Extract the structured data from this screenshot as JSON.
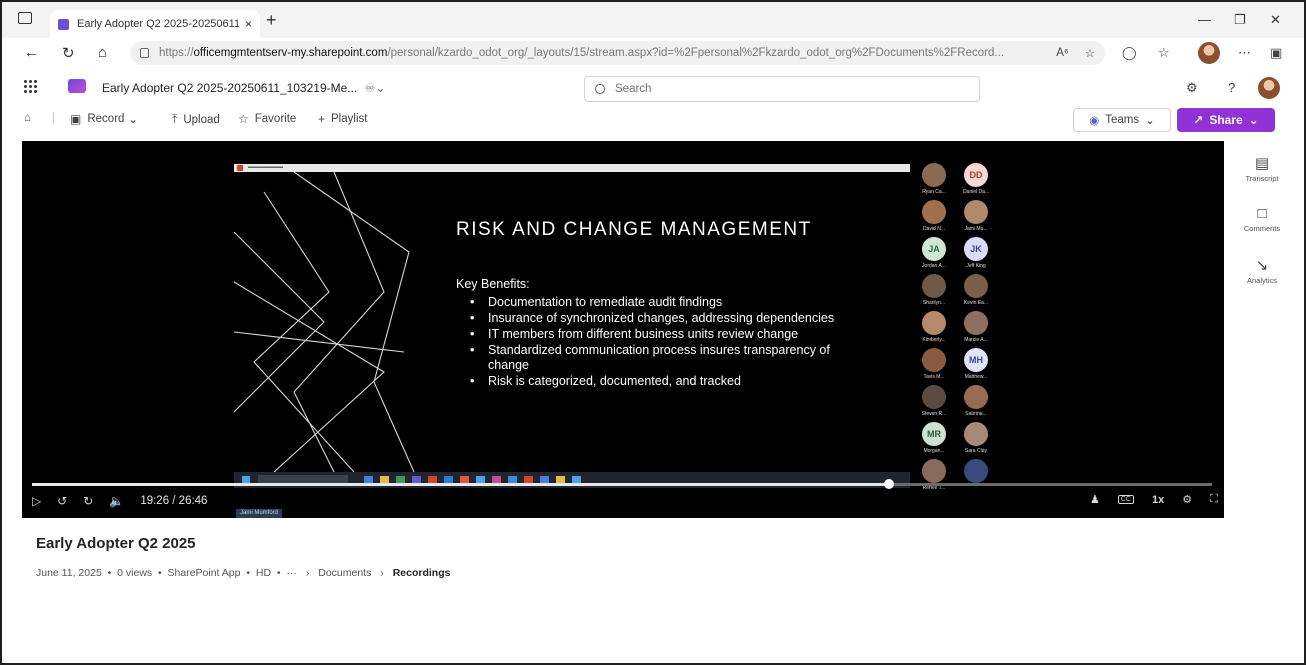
{
  "browser": {
    "tab_title": "Early Adopter Q2 2025-20250611",
    "tab_close": "×",
    "new_tab": "+",
    "url_prefix": "https://",
    "url_host": "officemgmtentserv-my.sharepoint.com",
    "url_path": "/personal/kzardo_odot_org/_layouts/15/stream.aspx?id=%2Fpersonal%2Fkzardo_odot_org%2FDocuments%2FRecord..."
  },
  "app": {
    "doc_title": "Early Adopter Q2 2025-20250611_103219-Me...",
    "search_placeholder": "Search"
  },
  "toolbar": {
    "record": "Record",
    "upload": "Upload",
    "favorite": "Favorite",
    "playlist": "Playlist",
    "teams": "Teams",
    "share": "Share"
  },
  "slide": {
    "title": "RISK AND CHANGE MANAGEMENT",
    "subtitle": "Key Benefits:",
    "bullets": [
      "Documentation to remediate audit findings",
      "Insurance of synchronized changes, addressing dependencies",
      "IT members from different business units review change",
      "Standardized communication process insures transparency of change",
      "Risk is categorized, documented, and tracked"
    ]
  },
  "participants": [
    {
      "initials": "",
      "name": "Ryan Ca...",
      "bg": "#8a6a52"
    },
    {
      "initials": "DD",
      "name": "Daniel Da...",
      "bg": "#f7d9d0",
      "fg": "#a04030"
    },
    {
      "initials": "",
      "name": "David N...",
      "bg": "#a0704e"
    },
    {
      "initials": "",
      "name": "Jami Mu...",
      "bg": "#b08a6a"
    },
    {
      "initials": "JA",
      "name": "Jordan A...",
      "bg": "#cfe8d4",
      "fg": "#2d6b3a"
    },
    {
      "initials": "JK",
      "name": "Jeff King",
      "bg": "#d8defa",
      "fg": "#3a4aa0"
    },
    {
      "initials": "",
      "name": "Sharilyn...",
      "bg": "#6e5848"
    },
    {
      "initials": "",
      "name": "Kevin Ea...",
      "bg": "#7a5e4a"
    },
    {
      "initials": "",
      "name": "Kimberly...",
      "bg": "#b48a6a"
    },
    {
      "initials": "",
      "name": "Marcie A...",
      "bg": "#8e7060"
    },
    {
      "initials": "",
      "name": "Tavis M...",
      "bg": "#8a5a40"
    },
    {
      "initials": "MH",
      "name": "Matthew...",
      "bg": "#dfe4fb",
      "fg": "#3a4aa0"
    },
    {
      "initials": "",
      "name": "Steven R...",
      "bg": "#5a4a40"
    },
    {
      "initials": "",
      "name": "Sabrina...",
      "bg": "#9a6a4e"
    },
    {
      "initials": "MR",
      "name": "Morgan...",
      "bg": "#cfe2d2",
      "fg": "#2d5a3a"
    },
    {
      "initials": "",
      "name": "Sara Clay",
      "bg": "#a88a78"
    },
    {
      "initials": "",
      "name": "Renee T...",
      "bg": "#8a6a5a"
    },
    {
      "initials": "",
      "name": "",
      "bg": "#3a4a7a"
    }
  ],
  "speaker_tag": "Jami Mumford",
  "player": {
    "time": "19:26 / 26:46",
    "speed": "1x",
    "progress_fraction": 0.726
  },
  "rail": {
    "transcript": "Transcript",
    "comments": "Comments",
    "analytics": "Analytics"
  },
  "video_info": {
    "title": "Early Adopter Q2 2025",
    "date": "June 11, 2025",
    "views": "0 views",
    "source": "SharePoint App",
    "quality": "HD",
    "more": "···",
    "crumb1": "Documents",
    "crumb2": "Recordings"
  }
}
